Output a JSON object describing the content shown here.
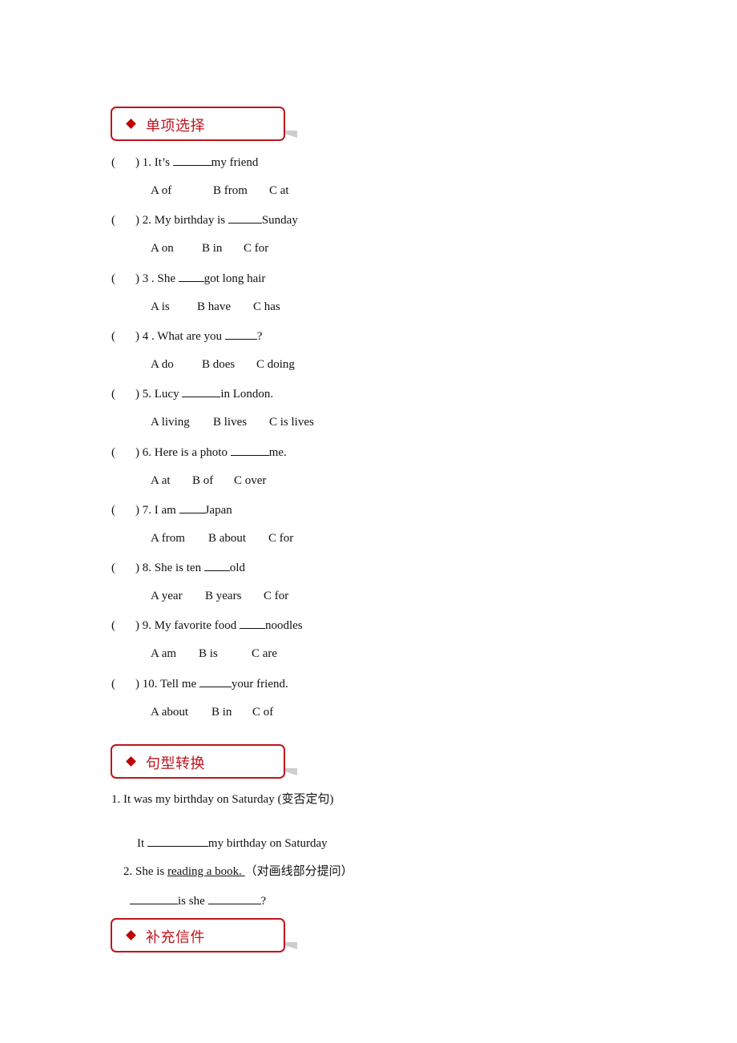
{
  "sections": {
    "multiple_choice": {
      "title": "单项选择",
      "questions": [
        {
          "open": "(",
          "close": ")",
          "number": "1.",
          "before": "It’s ",
          "after": "my friend",
          "options": [
            "A of",
            "B from",
            "C at"
          ]
        },
        {
          "open": "(",
          "close": ")",
          "number": "2.",
          "before": "My birthday is ",
          "after": "Sunday",
          "options": [
            "A on",
            "B in",
            "C for"
          ]
        },
        {
          "open": "(",
          "close": ")",
          "number": "3 .",
          "before": "She ",
          "after": "got long hair",
          "options": [
            "A is",
            "B have",
            "C has"
          ]
        },
        {
          "open": "(",
          "close": ")",
          "number": "4 .",
          "before": "What are you ",
          "after": "?",
          "options": [
            "A do",
            "B does",
            "C doing"
          ]
        },
        {
          "open": "(",
          "close": ")",
          "number": "5.",
          "before": "Lucy ",
          "after": "in London.",
          "options": [
            "A living",
            "B lives",
            "C is lives"
          ]
        },
        {
          "open": "(",
          "close": ")",
          "number": "6.",
          "before": "Here is a photo ",
          "after": "me.",
          "options": [
            "A at",
            "B of",
            "C over"
          ]
        },
        {
          "open": "(",
          "close": ")",
          "number": "7.",
          "before": "I am ",
          "after": "Japan",
          "options": [
            "A from",
            "B about",
            "C for"
          ]
        },
        {
          "open": "(",
          "close": ")",
          "number": "8.",
          "before": "She is ten ",
          "after": "old",
          "options": [
            "A year",
            "B years",
            "C for"
          ]
        },
        {
          "open": "(",
          "close": ")",
          "number": "9.",
          "before": "My favorite food ",
          "after": "noodles",
          "options": [
            "A am",
            "B is",
            "C are"
          ]
        },
        {
          "open": "(",
          "close": ")",
          "number": "10.",
          "before": "Tell me ",
          "after": "your friend.",
          "options": [
            "A about",
            "B in",
            "C of"
          ]
        }
      ]
    },
    "sentence_transform": {
      "title": "句型转换",
      "items": [
        {
          "prompt": "1. It was my birthday on Saturday (变否定句)",
          "answer_before": "It ",
          "answer_after": "my birthday on Saturday"
        },
        {
          "prompt_before": "2. She is ",
          "prompt_underlined": "reading a book. ",
          "prompt_after": "（对画线部分提问）",
          "answer_mid": "is she ",
          "answer_end": "?"
        }
      ]
    },
    "supplement": {
      "title": "补充信件"
    }
  },
  "colors": {
    "accent": "#c0141c",
    "diamond": "#c00000",
    "shadow": "#c8c8c8"
  }
}
